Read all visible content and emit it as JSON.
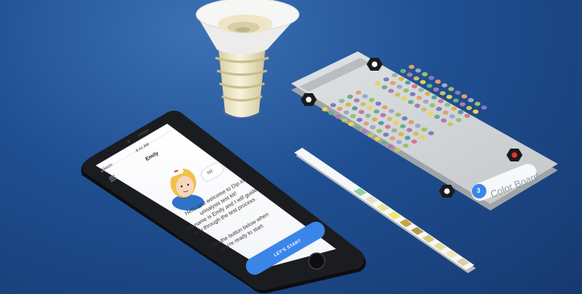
{
  "phone": {
    "status_carrier": "Sketch",
    "status_time": "9:41 AM",
    "assistant_name": "Emily",
    "greeting": "Hi!",
    "intro_line1": "Hello and welcome to Dip.io",
    "intro_line2": "urinalysis test kit!",
    "intro_line3": "My name is Emily and I will guide",
    "intro_line4": "you through the test process.",
    "instruction_line1": "Click the button below when",
    "instruction_line2": "you're ready to start.",
    "start_button": "LET'S START"
  },
  "color_board": {
    "label": "Color Board",
    "badge_number": "3"
  },
  "colors": {
    "background": "#1f4f92",
    "accent_blue": "#3a86e8",
    "board": "#cfd3d6"
  },
  "icons": {
    "menu": "hamburger-menu-icon",
    "fiducials": "hexagon-marker-icon"
  }
}
